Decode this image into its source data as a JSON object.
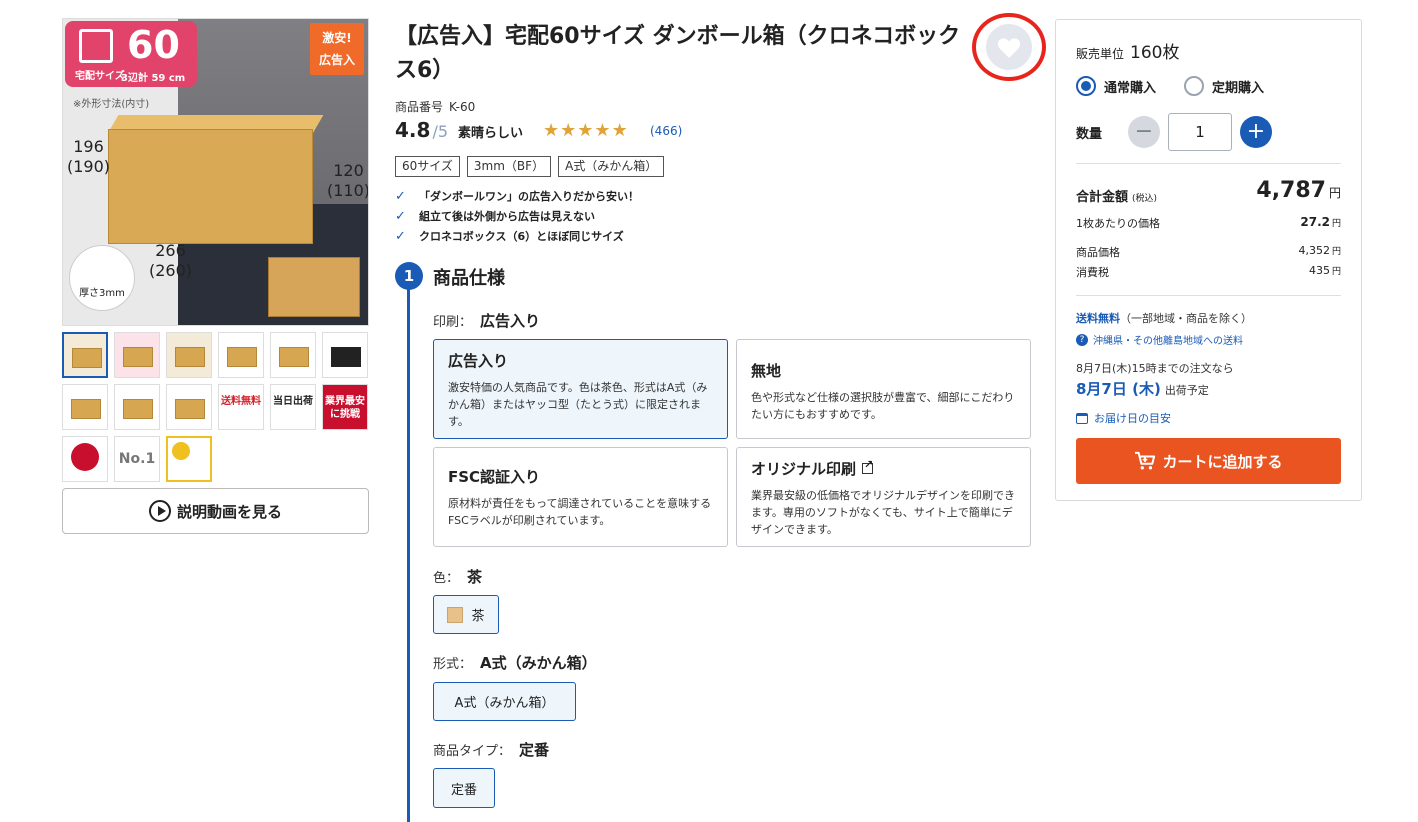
{
  "gallery": {
    "badge": {
      "size_number": "60",
      "size_label": "宅配サイズ",
      "sum_text": "3辺計 59 cm"
    },
    "cheap_badge": {
      "line1": "激安!",
      "line2": "広告入"
    },
    "note": "※外形寸法(内寸)",
    "dims": {
      "width": "196",
      "width_inner": "(190)",
      "height": "120",
      "height_inner": "(110)",
      "length": "266",
      "length_inner": "(260)"
    },
    "thickness": "厚さ3mm",
    "thumb_labels": {
      "free_ship": "送料無料",
      "same_day": "当日出荷",
      "lowest": "業界最安に挑戦",
      "no1": "No.1"
    },
    "video_button": "説明動画を見る"
  },
  "product": {
    "title": "【広告入】宅配60サイズ ダンボール箱（クロネコボックス6）",
    "sku_label": "商品番号",
    "sku": "K-60",
    "rating": "4.8",
    "rating_max": "/5",
    "rating_word": "素晴らしい",
    "stars": 5,
    "review_count": "(466)",
    "tags": [
      "60サイズ",
      "3mm（BF）",
      "A式（みかん箱）"
    ],
    "features": [
      "「ダンボールワン」の広告入りだから安い！",
      "組立て後は外側から広告は見えない",
      "クロネコボックス（6）とほぼ同じサイズ"
    ]
  },
  "spec": {
    "step_number": "1",
    "step_title": "商品仕様",
    "printing_label": "印刷：",
    "printing_value": "広告入り",
    "printing_options": [
      {
        "title": "広告入り",
        "desc": "激安特価の人気商品です。色は茶色、形式はA式（みかん箱）またはヤッコ型（たとう式）に限定されます。"
      },
      {
        "title": "無地",
        "desc": "色や形式など仕様の選択肢が豊富で、細部にこだわりたい方にもおすすめです。"
      },
      {
        "title": "FSC認証入り",
        "desc": "原材料が責任をもって調達されていることを意味するFSCラベルが印刷されています。"
      },
      {
        "title": "オリジナル印刷",
        "desc": "業界最安級の低価格でオリジナルデザインを印刷できます。専用のソフトがなくても、サイト上で簡単にデザインできます。"
      }
    ],
    "color_label": "色：",
    "color_value": "茶",
    "color_option": "茶",
    "form_label": "形式：",
    "form_value": "A式（みかん箱）",
    "form_option": "A式（みかん箱）",
    "type_label": "商品タイプ：",
    "type_value": "定番",
    "type_option": "定番"
  },
  "purchase": {
    "unit_label": "販売単位",
    "unit_value": "160枚",
    "radio_normal": "通常購入",
    "radio_subscribe": "定期購入",
    "qty_label": "数量",
    "qty_value": "1",
    "total_label": "合計金額",
    "total_tax_note": "(税込)",
    "total_value": "4,787",
    "yen": "円",
    "per_unit_label": "1枚あたりの価格",
    "per_unit_value": "27.2",
    "price_label": "商品価格",
    "price_value": "4,352",
    "tax_label": "消費税",
    "tax_value": "435",
    "free_ship": "送料無料",
    "free_ship_note": "（一部地域・商品を除く）",
    "okinawa_link": "沖縄県・その他離島地域への送料",
    "deadline": "8月7日(木)15時までの注文なら",
    "ship_date": "8月7日 (木)",
    "ship_suffix": "出荷予定",
    "delivery_link": "お届け日の目安",
    "cart_button": "カートに追加する",
    "accent_color": "#e95420",
    "brand_color": "#1a5bb5"
  }
}
